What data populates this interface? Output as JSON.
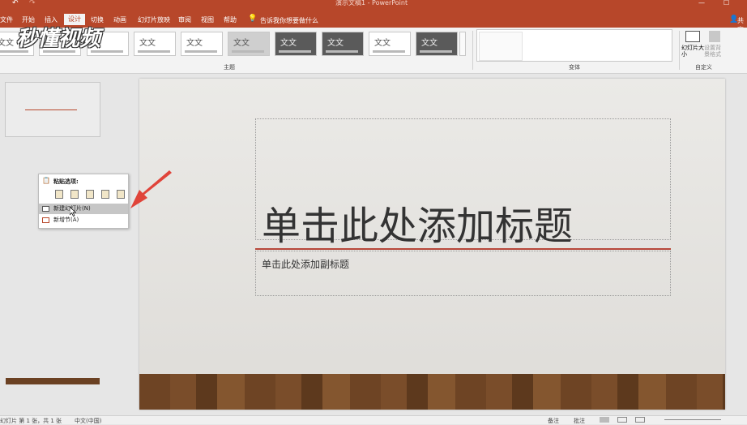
{
  "window": {
    "title": "演示文稿1 - PowerPoint",
    "user": "共享"
  },
  "tabs": [
    {
      "label": "文件"
    },
    {
      "label": "开始"
    },
    {
      "label": "插入"
    },
    {
      "label": "设计"
    },
    {
      "label": "切换"
    },
    {
      "label": "动画"
    },
    {
      "label": "幻灯片放映"
    },
    {
      "label": "审阅"
    },
    {
      "label": "视图"
    },
    {
      "label": "帮助"
    }
  ],
  "active_tab": "设计",
  "tell_me": "告诉我你想要做什么",
  "ribbon": {
    "theme_sample_text": "文文",
    "groups": {
      "themes": "主题",
      "variants": "变体",
      "customize": "自定义"
    },
    "slide_size_label": "幻灯片大小",
    "format_bg_label": "设置背景格式"
  },
  "watermark": "秒懂视频",
  "context_menu": {
    "paste_options_label": "粘贴选项:",
    "items": [
      {
        "label": "新建幻灯片(N)"
      },
      {
        "label": "新增节(A)"
      }
    ]
  },
  "slide": {
    "title_placeholder": "单击此处添加标题",
    "subtitle_placeholder": "单击此处添加副标题"
  },
  "status": {
    "slide_info": "幻灯片 第 1 张，共 1 张",
    "language": "中文(中国)",
    "notes": "备注",
    "comments": "批注"
  },
  "colors": {
    "accent": "#b7472a",
    "title_line": "#b7473a",
    "annotation_arrow": "#e0443a"
  }
}
